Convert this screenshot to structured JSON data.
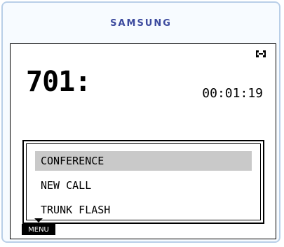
{
  "brand": {
    "name": "SAMSUNG"
  },
  "call": {
    "extension": "701:",
    "duration": "00:01:19",
    "status_icon": "handset-icon"
  },
  "menu": {
    "items": [
      {
        "label": "CONFERENCE",
        "selected": true
      },
      {
        "label": "NEW CALL",
        "selected": false
      },
      {
        "label": "TRUNK FLASH",
        "selected": false
      }
    ]
  },
  "softkeys": {
    "menu_label": "MENU"
  }
}
